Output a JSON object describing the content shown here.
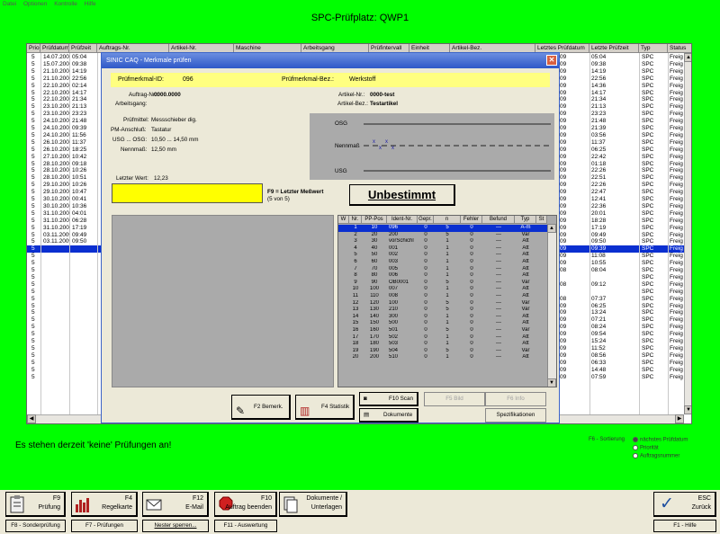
{
  "menu": [
    "Datei",
    "Optionen",
    "Kontrolle",
    "Hilfe"
  ],
  "window_title": "SPC-Prüfplatz: QWP1",
  "background_table": {
    "headers": [
      "Prio",
      "Prüfdatum",
      "Prüfzeit",
      "Auftrags-Nr.",
      "Artikel-Nr.",
      "Maschine",
      "Arbeitsgang",
      "Prüfintervall",
      "Einheit",
      "Artikel-Bez.",
      "Letztes Prüfdatum",
      "Letzte Prüfzeit",
      "Typ",
      "Status"
    ],
    "rows": [
      [
        "5",
        "14.07.2009",
        "05:04",
        "09",
        "05:04",
        "SPC",
        "Freig"
      ],
      [
        "5",
        "15.07.2009",
        "09:38",
        "09",
        "09:38",
        "SPC",
        "Freig"
      ],
      [
        "5",
        "21.10.2009",
        "14:19",
        "09",
        "14:19",
        "SPC",
        "Freig"
      ],
      [
        "5",
        "21.10.2009",
        "22:56",
        "09",
        "22:56",
        "SPC",
        "Freig"
      ],
      [
        "5",
        "22.10.2009",
        "02:14",
        "09",
        "14:36",
        "SPC",
        "Freig"
      ],
      [
        "5",
        "22.10.2009",
        "14:17",
        "09",
        "14:17",
        "SPC",
        "Freig"
      ],
      [
        "5",
        "22.10.2009",
        "21:34",
        "09",
        "21:34",
        "SPC",
        "Freig"
      ],
      [
        "5",
        "23.10.2009",
        "21:13",
        "09",
        "21:13",
        "SPC",
        "Freig"
      ],
      [
        "5",
        "23.10.2009",
        "23:23",
        "09",
        "23:23",
        "SPC",
        "Freig"
      ],
      [
        "5",
        "24.10.2009",
        "21:48",
        "09",
        "21:48",
        "SPC",
        "Freig"
      ],
      [
        "5",
        "24.10.2009",
        "09:39",
        "09",
        "21:39",
        "SPC",
        "Freig"
      ],
      [
        "5",
        "24.10.2009",
        "11:56",
        "09",
        "03:56",
        "SPC",
        "Freig"
      ],
      [
        "5",
        "26.10.2009",
        "11:37",
        "09",
        "11:37",
        "SPC",
        "Freig"
      ],
      [
        "5",
        "26.10.2009",
        "18:25",
        "09",
        "06:25",
        "SPC",
        "Freig"
      ],
      [
        "5",
        "27.10.2009",
        "10:42",
        "09",
        "22:42",
        "SPC",
        "Freig"
      ],
      [
        "5",
        "28.10.2009",
        "09:18",
        "09",
        "01:18",
        "SPC",
        "Freig"
      ],
      [
        "5",
        "28.10.2009",
        "10:26",
        "09",
        "22:26",
        "SPC",
        "Freig"
      ],
      [
        "5",
        "28.10.2009",
        "10:51",
        "09",
        "22:51",
        "SPC",
        "Freig"
      ],
      [
        "5",
        "29.10.2009",
        "10:26",
        "09",
        "22:26",
        "SPC",
        "Freig"
      ],
      [
        "5",
        "29.10.2009",
        "10:47",
        "09",
        "22:47",
        "SPC",
        "Freig"
      ],
      [
        "5",
        "30.10.2009",
        "00:41",
        "09",
        "12:41",
        "SPC",
        "Freig"
      ],
      [
        "5",
        "30.10.2009",
        "10:36",
        "09",
        "22:36",
        "SPC",
        "Freig"
      ],
      [
        "5",
        "31.10.2009",
        "04:01",
        "09",
        "20:01",
        "SPC",
        "Freig"
      ],
      [
        "5",
        "31.10.2009",
        "06:28",
        "09",
        "18:28",
        "SPC",
        "Freig"
      ],
      [
        "5",
        "31.10.2009",
        "17:19",
        "09",
        "17:19",
        "SPC",
        "Freig"
      ],
      [
        "5",
        "03.11.2009",
        "09:49",
        "09",
        "09:49",
        "SPC",
        "Freig"
      ],
      [
        "5",
        "03.11.2009",
        "09:50",
        "09",
        "09:50",
        "SPC",
        "Freig"
      ],
      [
        "5",
        "",
        "",
        "09",
        "09:39",
        "SPC",
        "Freig"
      ],
      [
        "5",
        "",
        "",
        "09",
        "11:08",
        "SPC",
        "Freig"
      ],
      [
        "5",
        "",
        "",
        "09",
        "10:55",
        "SPC",
        "Freig"
      ],
      [
        "5",
        "",
        "",
        "08",
        "08:04",
        "SPC",
        "Freig"
      ],
      [
        "5",
        "",
        "",
        "",
        "",
        "SPC",
        "Freig"
      ],
      [
        "5",
        "",
        "",
        "08",
        "09:12",
        "SPC",
        "Freig"
      ],
      [
        "5",
        "",
        "",
        "",
        "",
        "SPC",
        "Freig"
      ],
      [
        "5",
        "",
        "",
        "08",
        "07:37",
        "SPC",
        "Freig"
      ],
      [
        "5",
        "",
        "",
        "09",
        "06:25",
        "SPC",
        "Freig"
      ],
      [
        "5",
        "",
        "",
        "09",
        "13:24",
        "SPC",
        "Freig"
      ],
      [
        "5",
        "",
        "",
        "09",
        "07:21",
        "SPC",
        "Freig"
      ],
      [
        "5",
        "",
        "",
        "09",
        "08:24",
        "SPC",
        "Freig"
      ],
      [
        "5",
        "",
        "",
        "09",
        "09:54",
        "SPC",
        "Freig"
      ],
      [
        "5",
        "",
        "",
        "09",
        "15:24",
        "SPC",
        "Freig"
      ],
      [
        "5",
        "",
        "",
        "09",
        "11:52",
        "SPC",
        "Freig"
      ],
      [
        "5",
        "",
        "",
        "09",
        "08:56",
        "SPC",
        "Freig"
      ],
      [
        "5",
        "",
        "",
        "09",
        "06:33",
        "SPC",
        "Freig"
      ],
      [
        "5",
        "",
        "",
        "09",
        "14:48",
        "SPC",
        "Freig"
      ],
      [
        "5",
        "",
        "",
        "09",
        "07:59",
        "SPC",
        "Freig"
      ]
    ],
    "selected_index": 27
  },
  "dialog": {
    "title": "SINIC CAQ - Merkmale prüfen",
    "close": "✕",
    "merkmal_label": "Prüfmerkmal-ID:",
    "merkmal_value": "096",
    "merkmal_bez_label": "Prüfmerkmal-Bez.:",
    "merkmal_bez_value": "Werkstoff",
    "auftrag_label": "Auftrag-Nr.:",
    "auftrag_value": "0000.0000",
    "arbeitsgang_label": "Arbeitsgang:",
    "artikel_label": "Artikel-Nr.:",
    "artikel_value": "0000-test",
    "artikel_bez_label": "Artikel-Bez.:",
    "artikel_bez_value": "Testartikel",
    "pruefmittel_label": "Prüfmittel:",
    "pruefmittel_value": "Messschieber dig.",
    "pm_label": "PM-Anschluß:",
    "pm_value": "Tastatur",
    "usg_label": "USG ... OSG:",
    "usg_value": "10,50 ... 14,50 mm",
    "nennmass_label": "Nennmaß:",
    "nennmass_value": "12,50 mm",
    "letzter_label": "Letzter Wert:",
    "letzter_value": "12,23",
    "graph_osg": "OSG",
    "graph_nenn": "Nennmaß",
    "graph_usg": "USG",
    "f9_text": "F9 = Letzter Meßwert",
    "f9_sub": "(5 von 5)",
    "status": "Unbestimmt"
  },
  "result_table": {
    "headers": [
      "W",
      "Nr.",
      "PP-Pos",
      "Ident-Nr.",
      "Gepr.",
      "n",
      "Fehler",
      "Befund",
      "Typ",
      "St"
    ],
    "rows": [
      [
        "1",
        "10",
        "096",
        "0",
        "5",
        "0",
        "---",
        "A-m"
      ],
      [
        "2",
        "20",
        "200",
        "0",
        "5",
        "0",
        "---",
        "Var"
      ],
      [
        "3",
        "30",
        "vorSchichl",
        "0",
        "1",
        "0",
        "---",
        "Att"
      ],
      [
        "4",
        "40",
        "001",
        "0",
        "1",
        "0",
        "---",
        "Att"
      ],
      [
        "5",
        "50",
        "002",
        "0",
        "1",
        "0",
        "---",
        "Att"
      ],
      [
        "6",
        "60",
        "003",
        "0",
        "1",
        "0",
        "---",
        "Att"
      ],
      [
        "7",
        "70",
        "005",
        "0",
        "1",
        "0",
        "---",
        "Att"
      ],
      [
        "8",
        "80",
        "006",
        "0",
        "1",
        "0",
        "---",
        "Att"
      ],
      [
        "9",
        "90",
        "OB0001",
        "0",
        "5",
        "0",
        "---",
        "Var"
      ],
      [
        "10",
        "100",
        "007",
        "0",
        "1",
        "0",
        "---",
        "Att"
      ],
      [
        "11",
        "110",
        "008",
        "0",
        "1",
        "0",
        "---",
        "Att"
      ],
      [
        "12",
        "120",
        "100",
        "0",
        "5",
        "0",
        "---",
        "Var"
      ],
      [
        "13",
        "130",
        "210",
        "0",
        "5",
        "0",
        "---",
        "Var"
      ],
      [
        "14",
        "140",
        "300",
        "0",
        "1",
        "0",
        "---",
        "Att"
      ],
      [
        "15",
        "150",
        "500",
        "0",
        "1",
        "0",
        "---",
        "Att"
      ],
      [
        "16",
        "160",
        "501",
        "0",
        "5",
        "0",
        "---",
        "Var"
      ],
      [
        "17",
        "170",
        "502",
        "0",
        "1",
        "0",
        "---",
        "Att"
      ],
      [
        "18",
        "180",
        "503",
        "0",
        "1",
        "0",
        "---",
        "Att"
      ],
      [
        "19",
        "190",
        "504",
        "0",
        "5",
        "0",
        "---",
        "Var"
      ],
      [
        "20",
        "200",
        "510",
        "0",
        "1",
        "0",
        "---",
        "Att"
      ]
    ],
    "selected_index": 0
  },
  "dialog_buttons": {
    "f2": "F2 Bemerk.",
    "f4": "F4 Statistik",
    "f10": "F10 Scan",
    "dokumente": "Dokumente",
    "f5": "F5 Bild",
    "f6": "F6 Info",
    "spezifikationen": "Spezifikationen"
  },
  "message": "Es stehen derzeit 'keine' Prüfungen an!",
  "sort": {
    "label": "F6 - Sortierung",
    "options": [
      "nächstes Prüfdatum",
      "Priorität",
      "Auftragsnummer"
    ],
    "selected": 0
  },
  "function_keys": [
    {
      "key": "F9",
      "label": "Prüfung"
    },
    {
      "key": "F4",
      "label": "Regelkarte"
    },
    {
      "key": "F12",
      "label": "E-Mail"
    },
    {
      "key": "F10",
      "label": "Auftrag beenden"
    },
    {
      "key": "Dokumente /",
      "label": "Unterlagen"
    },
    {
      "key": "ESC",
      "label": "Zurück"
    }
  ],
  "small_keys": [
    "F8 - Sonderprüfung",
    "F7 - Prüfungen",
    "Nester sperren...",
    "F11 - Auswertung",
    "F1 - Hilfe"
  ],
  "colors": {
    "background": "#00ff00",
    "selection": "#0a2fd0",
    "highlight": "#ffff80",
    "status_yellow": "#ffff00"
  }
}
